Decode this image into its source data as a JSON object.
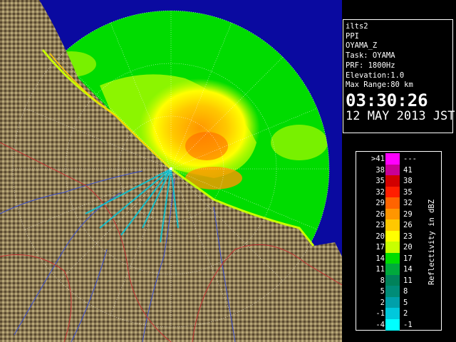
{
  "info": {
    "lines": [
      "ilts2",
      "PPI",
      "OYAMA_Z",
      "Task: OYAMA",
      "PRF: 1800Hz",
      "Elevation:1.0",
      "Max Range:80 km"
    ],
    "time": "03:30:26",
    "date": "12 MAY 2013 JST"
  },
  "legend": {
    "title": "Reflectivity in dBZ",
    "rows": [
      {
        "low": ">41",
        "high": "---",
        "color": "#ff00ff"
      },
      {
        "low": "38",
        "high": "41",
        "color": "#c80096"
      },
      {
        "low": "35",
        "high": "38",
        "color": "#d20000"
      },
      {
        "low": "32",
        "high": "35",
        "color": "#ff1e00"
      },
      {
        "low": "29",
        "high": "32",
        "color": "#ff6400"
      },
      {
        "low": "26",
        "high": "29",
        "color": "#ff9600"
      },
      {
        "low": "23",
        "high": "26",
        "color": "#ffc800"
      },
      {
        "low": "20",
        "high": "23",
        "color": "#ffff00"
      },
      {
        "low": "17",
        "high": "20",
        "color": "#c8ff00"
      },
      {
        "low": "14",
        "high": "17",
        "color": "#00dc00"
      },
      {
        "low": "11",
        "high": "14",
        "color": "#00aa3c"
      },
      {
        "low": "8",
        "high": "11",
        "color": "#00825a"
      },
      {
        "low": "5",
        "high": "8",
        "color": "#008c78"
      },
      {
        "low": "2",
        "high": "5",
        "color": "#00a0aa"
      },
      {
        "low": "-1",
        "high": "2",
        "color": "#00c8dc"
      },
      {
        "low": "-4",
        "high": "-1",
        "color": "#00ffff"
      }
    ]
  },
  "colors": {
    "sea": "#0a0aa0",
    "range_disk": "#1e64dc",
    "land": "#8c7a55",
    "echo_green": "#00dc00"
  }
}
